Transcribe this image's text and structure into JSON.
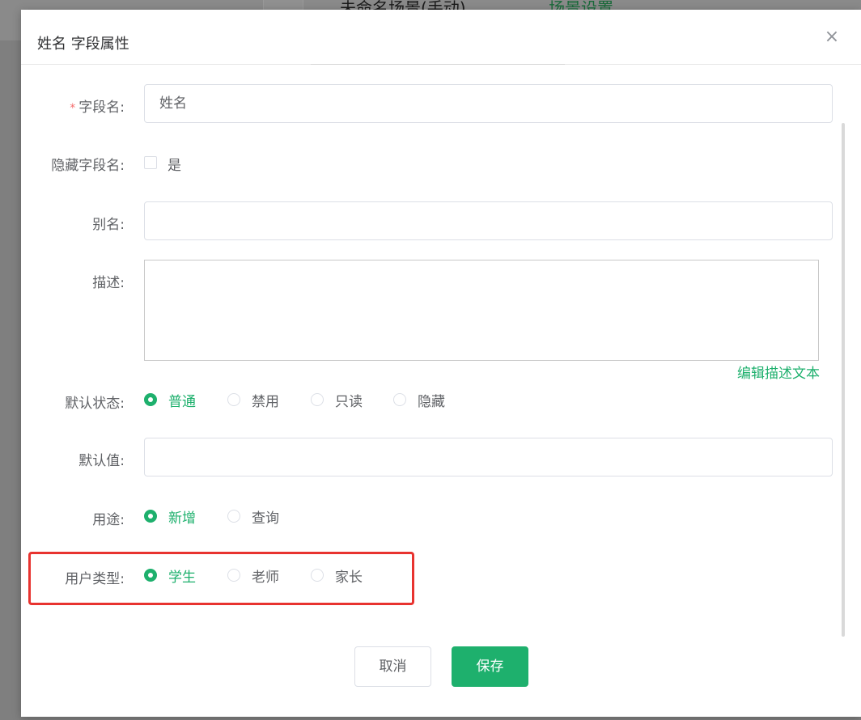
{
  "background": {
    "page_title": "未命名场景(手动)",
    "page_link": "场景设置"
  },
  "dialog": {
    "title": "姓名 字段属性",
    "close_icon": "close-icon",
    "fields": {
      "field_name": {
        "label": "字段名:",
        "required_mark": "*",
        "value": "姓名"
      },
      "hide_field_name": {
        "label": "隐藏字段名:",
        "checkbox_label": "是",
        "checked": false
      },
      "alias": {
        "label": "别名:",
        "value": ""
      },
      "description": {
        "label": "描述:",
        "value": "",
        "edit_link": "编辑描述文本"
      },
      "default_state": {
        "label": "默认状态:",
        "options": [
          "普通",
          "禁用",
          "只读",
          "隐藏"
        ],
        "selected": "普通"
      },
      "default_value": {
        "label": "默认值:",
        "value": ""
      },
      "purpose": {
        "label": "用途:",
        "options": [
          "新增",
          "查询"
        ],
        "selected": "新增"
      },
      "user_type": {
        "label": "用户类型:",
        "options": [
          "学生",
          "老师",
          "家长"
        ],
        "selected": "学生"
      }
    },
    "buttons": {
      "cancel": "取消",
      "save": "保存"
    }
  },
  "colors": {
    "accent": "#1eb06d",
    "required": "#f56c6c",
    "highlight": "#e8332f",
    "overlay": "#7f7f7f"
  }
}
